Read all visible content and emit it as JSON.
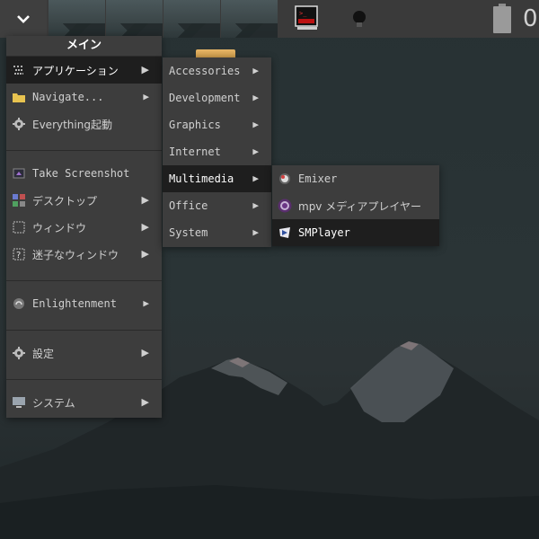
{
  "main_menu": {
    "title": "メイン",
    "items": [
      {
        "label": "アプリケーション",
        "icon": "applications-icon",
        "submenu": true,
        "selected": true
      },
      {
        "label": "Navigate...",
        "icon": "folder-icon",
        "submenu": true
      },
      {
        "label": "Everything起動",
        "icon": "gear-icon",
        "submenu": false
      },
      {
        "label": "Take Screenshot",
        "icon": "screenshot-icon",
        "submenu": false
      },
      {
        "label": "デスクトップ",
        "icon": "desktop-icon",
        "submenu": true
      },
      {
        "label": "ウィンドウ",
        "icon": "window-icon",
        "submenu": true
      },
      {
        "label": "迷子なウィンドウ",
        "icon": "lost-window-icon",
        "submenu": true
      },
      {
        "label": "Enlightenment",
        "icon": "enlightenment-icon",
        "submenu": true
      },
      {
        "label": "設定",
        "icon": "gear-icon",
        "submenu": true
      },
      {
        "label": "システム",
        "icon": "monitor-icon",
        "submenu": true
      }
    ]
  },
  "apps_menu": {
    "items": [
      {
        "label": "Accessories"
      },
      {
        "label": "Development"
      },
      {
        "label": "Graphics"
      },
      {
        "label": "Internet"
      },
      {
        "label": "Multimedia",
        "selected": true
      },
      {
        "label": "Office"
      },
      {
        "label": "System"
      }
    ]
  },
  "multimedia_menu": {
    "items": [
      {
        "label": "Emixer",
        "icon": "emixer-icon"
      },
      {
        "label": "mpv メディアプレイヤー",
        "icon": "mpv-icon"
      },
      {
        "label": "SMPlayer",
        "icon": "smplayer-icon",
        "selected": true
      }
    ]
  },
  "shelf": {
    "clock_fragment": "0",
    "icons": [
      "start-menu-icon",
      "terminal-icon",
      "lightbulb-icon",
      "battery-icon"
    ]
  },
  "colors": {
    "menu_bg": "#3d3d3d",
    "selected_bg": "#1e1e1e",
    "shelf_bg": "#3a3a3a",
    "desktop_bg": "#273133"
  }
}
